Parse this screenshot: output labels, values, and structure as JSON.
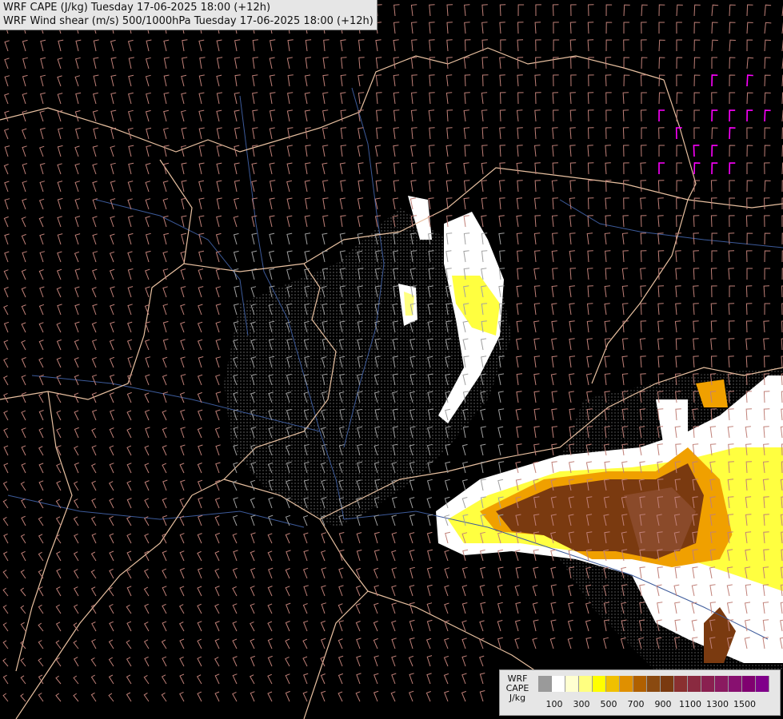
{
  "titles": {
    "line1": "WRF CAPE (J/kg) Tuesday 17-06-2025 18:00 (+12h)",
    "line2": "WRF Wind shear (m/s) 500/1000hPa Tuesday 17-06-2025 18:00 (+12h)"
  },
  "legend": {
    "label_line1": "WRF",
    "label_line2": "CAPE",
    "label_line3": "J/kg",
    "colors": [
      "#9a9a9a",
      "#ffffff",
      "#ffffd0",
      "#ffff80",
      "#ffff00",
      "#f0c000",
      "#e09000",
      "#b06000",
      "#8a4a10",
      "#7a3a10",
      "#8a3030",
      "#8a2a40",
      "#8a2050",
      "#8a1a60",
      "#881070",
      "#800070",
      "#80008a"
    ],
    "ticks": [
      "100",
      "300",
      "500",
      "700",
      "900",
      "1100",
      "1300",
      "1500"
    ]
  },
  "map": {
    "cape_color_light": "#ffffff",
    "cape_color_yellow": "#ffff40",
    "cape_color_orange": "#f0a000",
    "cape_color_brown": "#7a3a10",
    "border_color": "#e8c0a0",
    "river_color": "#3c5a9a",
    "barb_color_warm": "#c08078",
    "barb_color_cool": "#a0a0a0",
    "barb_color_strong": "#ff00ff"
  }
}
